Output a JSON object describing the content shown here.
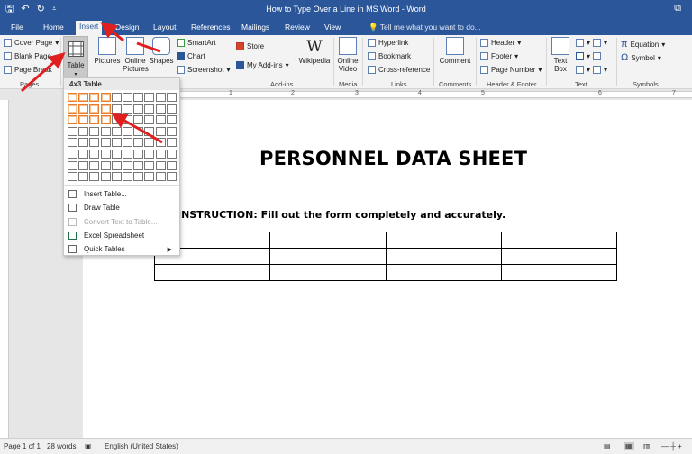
{
  "window": {
    "title": "How to Type Over a Line in MS Word - Word",
    "qat_save": "🖫",
    "qat_undo": "↶",
    "qat_redo": "↻",
    "qat_customize": "⩡",
    "restore_icon": "⧉"
  },
  "tabs": [
    {
      "label": "File"
    },
    {
      "label": "Home"
    },
    {
      "label": "Insert"
    },
    {
      "label": "Design"
    },
    {
      "label": "Layout"
    },
    {
      "label": "References"
    },
    {
      "label": "Mailings"
    },
    {
      "label": "Review"
    },
    {
      "label": "View"
    }
  ],
  "tell_me": "Tell me what you want to do...",
  "ribbon": {
    "pages": {
      "cover_page": "Cover Page",
      "blank_page": "Blank Page",
      "page_break": "Page Break",
      "label": "Pages"
    },
    "tables": {
      "table": "Table",
      "label": "Tables"
    },
    "illustrations": {
      "pictures": "Pictures",
      "online_pictures_1": "Online",
      "online_pictures_2": "Pictures",
      "shapes": "Shapes",
      "smartart": "SmartArt",
      "chart": "Chart",
      "screenshot": "Screenshot"
    },
    "addins": {
      "store": "Store",
      "my_addins": "My Add-ins",
      "wikipedia": "Wikipedia",
      "wikipedia_glyph": "W",
      "label": "Add-ins"
    },
    "media": {
      "online_video_1": "Online",
      "online_video_2": "Video",
      "label": "Media"
    },
    "links": {
      "hyperlink": "Hyperlink",
      "bookmark": "Bookmark",
      "cross_reference": "Cross-reference",
      "label": "Links"
    },
    "comments": {
      "comment": "Comment",
      "label": "Comments"
    },
    "header_footer": {
      "header": "Header",
      "footer": "Footer",
      "page_number": "Page Number",
      "label": "Header & Footer"
    },
    "text": {
      "text_box_1": "Text",
      "text_box_2": "Box",
      "label": "Text"
    },
    "symbols": {
      "equation": "Equation",
      "symbol": "Symbol",
      "equation_glyph": "π",
      "symbol_glyph": "Ω",
      "label": "Symbols"
    }
  },
  "ruler_numbers": [
    "1",
    "2",
    "3",
    "4",
    "5",
    "6",
    "7"
  ],
  "dropdown": {
    "header": "4x3 Table",
    "grid_cols": 10,
    "grid_rows": 8,
    "selected_cols": 4,
    "selected_rows": 3,
    "items": [
      {
        "label": "Insert Table...",
        "enabled": true
      },
      {
        "label": "Draw Table",
        "enabled": true
      },
      {
        "label": "Convert Text to Table...",
        "enabled": false
      },
      {
        "label": "Excel Spreadsheet",
        "enabled": true
      },
      {
        "label": "Quick Tables",
        "enabled": true,
        "submenu": true
      }
    ]
  },
  "document": {
    "title": "PERSONNEL DATA SHEET",
    "instruction": "INSTRUCTION: Fill out the form completely and accurately.",
    "table_rows": 3,
    "table_cols": 4
  },
  "status": {
    "page": "Page 1 of 1",
    "words": "28 words",
    "language": "English (United States)"
  },
  "colors": {
    "accent": "#2b579a",
    "selection": "#e97b2d",
    "annotation_arrow": "#e02020"
  }
}
